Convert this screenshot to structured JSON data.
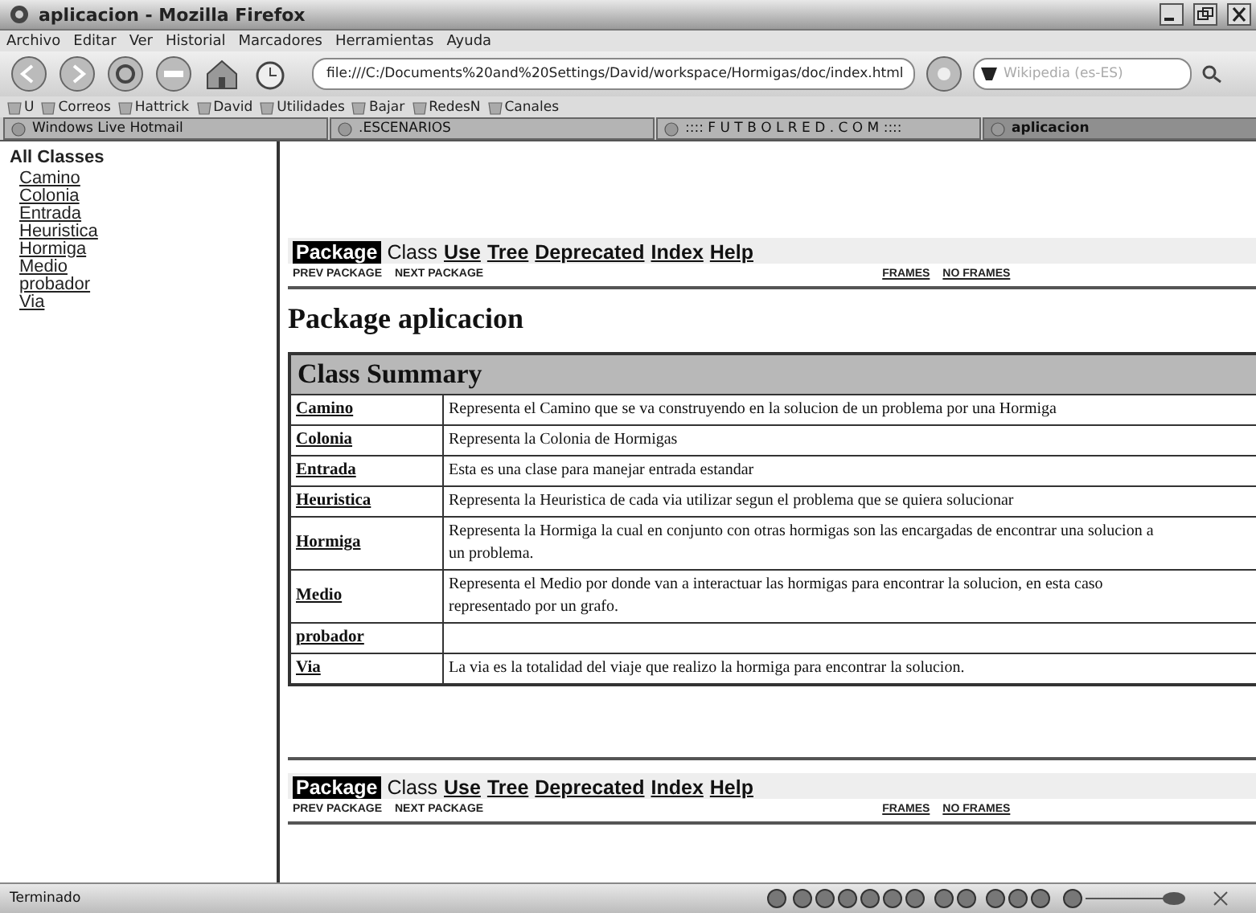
{
  "window": {
    "title": "aplicacion - Mozilla Firefox"
  },
  "menu": [
    "Archivo",
    "Editar",
    "Ver",
    "Historial",
    "Marcadores",
    "Herramientas",
    "Ayuda"
  ],
  "address": {
    "value": "file:///C:/Documents%20and%20Settings/David/workspace/Hormigas/doc/index.html"
  },
  "search": {
    "placeholder": "Wikipedia (es-ES)"
  },
  "bookmarks": [
    "U",
    "Correos",
    "Hattrick",
    "David",
    "Utilidades",
    "Bajar",
    "RedesN",
    "Canales"
  ],
  "tabs": [
    {
      "label": "Windows Live Hotmail",
      "selected": false
    },
    {
      "label": ".ESCENARIOS",
      "selected": false
    },
    {
      "label": ":::: F U T B O L R E D . C O M ::::",
      "selected": false
    },
    {
      "label": "aplicacion",
      "selected": true
    }
  ],
  "sidebar": {
    "title": "All Classes",
    "items": [
      "Camino",
      "Colonia",
      "Entrada",
      "Heuristica",
      "Hormiga",
      "Medio",
      "probador",
      "Via"
    ]
  },
  "top_nav": {
    "items": [
      {
        "label": "Package",
        "kind": "current"
      },
      {
        "label": "Class",
        "kind": "plain"
      },
      {
        "label": "Use",
        "kind": "link"
      },
      {
        "label": "Tree",
        "kind": "link"
      },
      {
        "label": "Deprecated",
        "kind": "link"
      },
      {
        "label": "Index",
        "kind": "link"
      },
      {
        "label": "Help",
        "kind": "link"
      }
    ],
    "sub_left": [
      "PREV PACKAGE",
      "NEXT PACKAGE"
    ],
    "sub_right": [
      "FRAMES",
      "NO FRAMES"
    ]
  },
  "heading": "Package aplicacion",
  "table": {
    "title": "Class Summary",
    "rows": [
      {
        "name": "Camino",
        "description": "Representa el Camino que se va construyendo en la solucion de un problema por una Hormiga"
      },
      {
        "name": "Colonia",
        "description": "Representa la Colonia de Hormigas"
      },
      {
        "name": "Entrada",
        "description": "Esta es una clase para manejar entrada estandar"
      },
      {
        "name": "Heuristica",
        "description": "Representa la Heuristica de cada via utilizar segun el problema que se quiera solucionar"
      },
      {
        "name": "Hormiga",
        "description": "Representa la Hormiga la cual en conjunto con otras hormigas son las encargadas de encontrar una solucion a\nun problema."
      },
      {
        "name": "Medio",
        "description": "Representa el Medio por donde van a interactuar las hormigas para encontrar la solucion, en esta caso\nrepresentado por un grafo."
      },
      {
        "name": "probador",
        "description": ""
      },
      {
        "name": "Via",
        "description": "La via es la totalidad del viaje que realizo la hormiga para encontrar la solucion."
      }
    ]
  },
  "bottom_nav": {
    "items": [
      {
        "label": "Package",
        "kind": "current"
      },
      {
        "label": "Class",
        "kind": "plain"
      },
      {
        "label": "Use",
        "kind": "link"
      },
      {
        "label": "Tree",
        "kind": "link"
      },
      {
        "label": "Deprecated",
        "kind": "link"
      },
      {
        "label": "Index",
        "kind": "link"
      },
      {
        "label": "Help",
        "kind": "link"
      }
    ],
    "sub_left": [
      "PREV PACKAGE",
      "NEXT PACKAGE"
    ],
    "sub_right": [
      "FRAMES",
      "NO FRAMES"
    ]
  },
  "status_bar": {
    "text": "Terminado"
  }
}
